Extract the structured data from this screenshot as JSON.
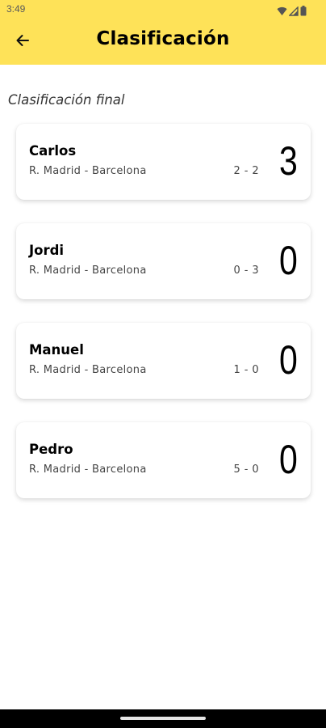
{
  "status_bar": {
    "time": "3:49",
    "icons": [
      "wifi-icon",
      "signal-icon",
      "battery-icon"
    ]
  },
  "app_bar": {
    "back_icon": "arrow-left-icon",
    "title": "Clasificación",
    "background_color": "#FEE258"
  },
  "section": {
    "title": "Clasificación final"
  },
  "standings": [
    {
      "name": "Carlos",
      "match": "R. Madrid - Barcelona",
      "score": "2 - 2",
      "points": "3"
    },
    {
      "name": "Jordi",
      "match": "R. Madrid - Barcelona",
      "score": "0 - 3",
      "points": "0"
    },
    {
      "name": "Manuel",
      "match": "R. Madrid - Barcelona",
      "score": "1 - 0",
      "points": "0"
    },
    {
      "name": "Pedro",
      "match": "R. Madrid - Barcelona",
      "score": "5 - 0",
      "points": "0"
    }
  ]
}
